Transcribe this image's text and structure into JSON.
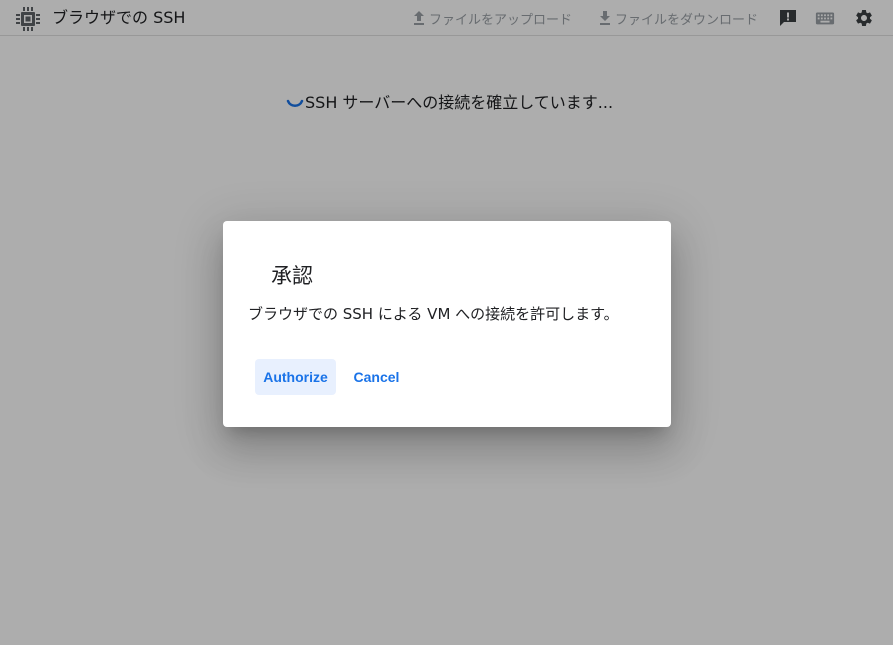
{
  "app": {
    "title": "ブラウザでの SSH"
  },
  "toolbar": {
    "upload_label": "ファイルをアップロード",
    "download_label": "ファイルをダウンロード",
    "icons": [
      "chip-icon",
      "upload-icon",
      "download-icon",
      "feedback-icon",
      "keyboard-icon",
      "settings-gear-icon"
    ]
  },
  "main": {
    "status_text": "SSH サーバーへの接続を確立しています..."
  },
  "dialog": {
    "title": "承認",
    "message": "ブラウザでの SSH による VM への接続を許可します。",
    "authorize_label": "Authorize",
    "cancel_label": "Cancel"
  },
  "colors": {
    "accent": "#1a73e8",
    "authorize_bg": "#e8f0fe",
    "scrim": "rgba(0,0,0,0.32)",
    "icon_dark": "#3c4043",
    "icon_disabled": "#9aa0a6"
  }
}
